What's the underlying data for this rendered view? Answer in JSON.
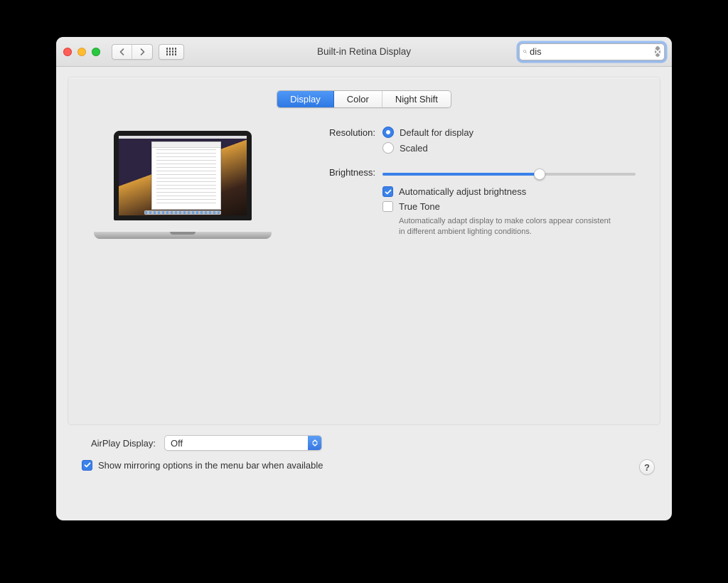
{
  "window": {
    "title": "Built-in Retina Display"
  },
  "search": {
    "value": "dis"
  },
  "tabs": {
    "display": "Display",
    "color": "Color",
    "nightshift": "Night Shift",
    "active": "display"
  },
  "settings": {
    "resolution_label": "Resolution:",
    "resolution_default": "Default for display",
    "resolution_scaled": "Scaled",
    "resolution_selected": "default",
    "brightness_label": "Brightness:",
    "brightness_value": 62,
    "auto_brightness_label": "Automatically adjust brightness",
    "auto_brightness_checked": true,
    "truetone_label": "True Tone",
    "truetone_checked": false,
    "truetone_desc": "Automatically adapt display to make colors appear consistent in different ambient lighting conditions."
  },
  "airplay": {
    "label": "AirPlay Display:",
    "value": "Off"
  },
  "mirroring": {
    "checked": true,
    "label": "Show mirroring options in the menu bar when available"
  },
  "help": "?"
}
